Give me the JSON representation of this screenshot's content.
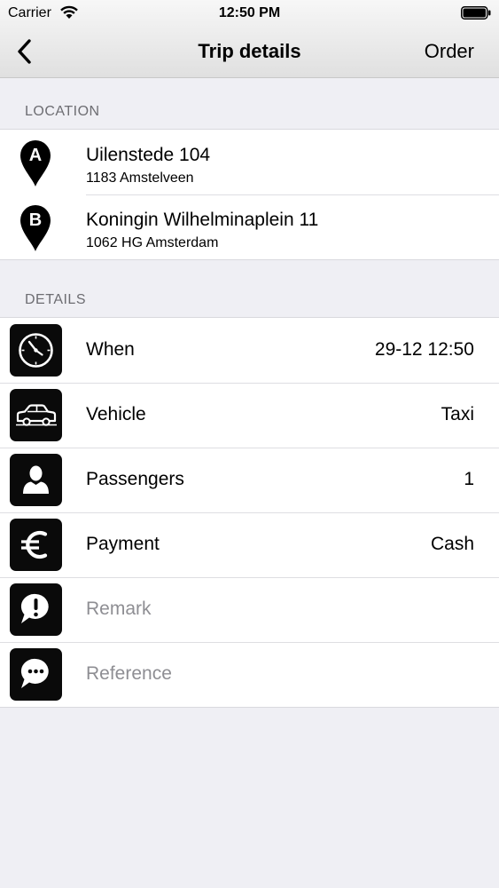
{
  "status": {
    "carrier": "Carrier",
    "time": "12:50 PM"
  },
  "nav": {
    "title": "Trip details",
    "order_label": "Order"
  },
  "location": {
    "header": "LOCATION",
    "items": [
      {
        "pin": "A",
        "street": "Uilenstede 104",
        "city": "1183 Amstelveen"
      },
      {
        "pin": "B",
        "street": "Koningin Wilhelminaplein 11",
        "city": "1062 HG Amsterdam"
      }
    ]
  },
  "details": {
    "header": "DETAILS",
    "rows": [
      {
        "icon": "clock-icon",
        "label": "When",
        "value": "29-12 12:50"
      },
      {
        "icon": "taxi-icon",
        "label": "Vehicle",
        "value": "Taxi"
      },
      {
        "icon": "passenger-icon",
        "label": "Passengers",
        "value": "1"
      },
      {
        "icon": "euro-icon",
        "label": "Payment",
        "value": "Cash"
      },
      {
        "icon": "remark-icon",
        "placeholder": "Remark"
      },
      {
        "icon": "reference-icon",
        "placeholder": "Reference"
      }
    ]
  }
}
